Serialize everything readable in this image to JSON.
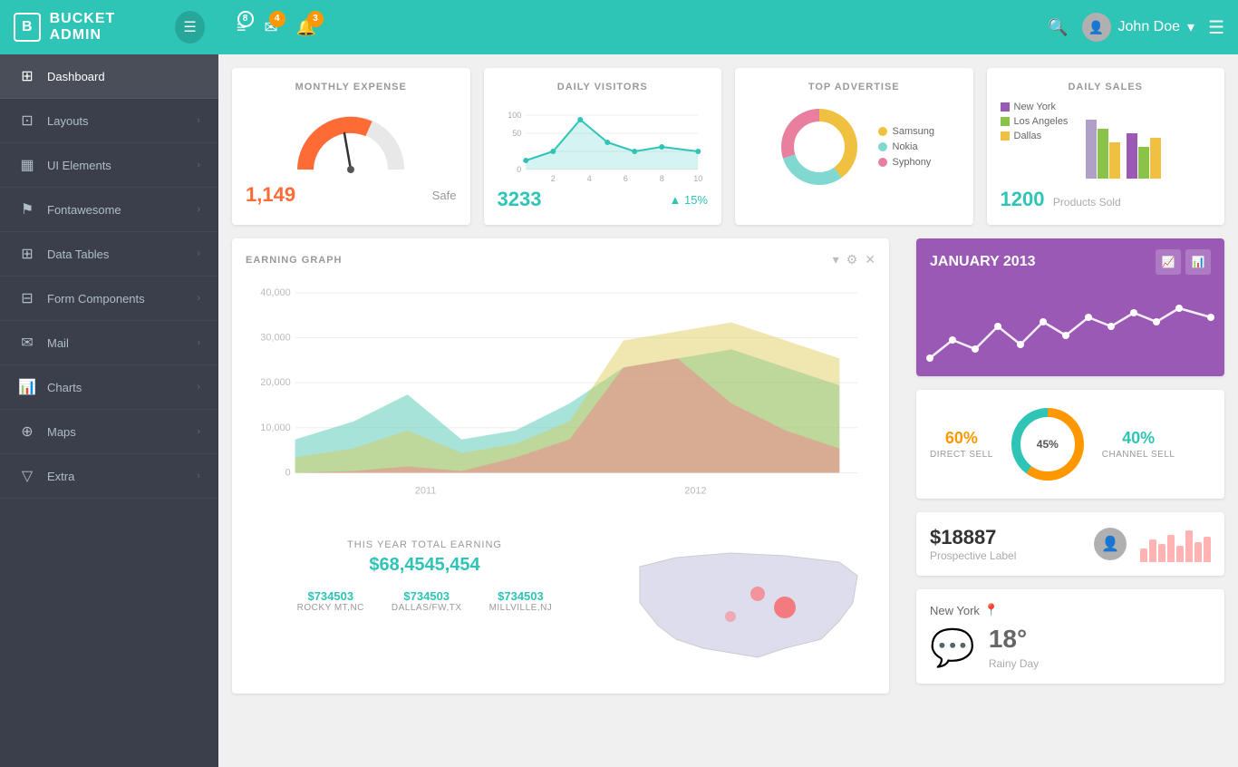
{
  "brand": {
    "title": "BUCKET ADMIN",
    "icon": "B"
  },
  "header": {
    "badges": {
      "menu": "8",
      "mail": "4",
      "bell": "3"
    },
    "user": "John Doe",
    "search_placeholder": "Search..."
  },
  "sidebar": {
    "items": [
      {
        "label": "Dashboard",
        "icon": "⊞",
        "active": true
      },
      {
        "label": "Layouts",
        "icon": "⊡",
        "active": false
      },
      {
        "label": "UI Elements",
        "icon": "▦",
        "active": false
      },
      {
        "label": "Fontawesome",
        "icon": "⚑",
        "active": false
      },
      {
        "label": "Data Tables",
        "icon": "⊞",
        "active": false
      },
      {
        "label": "Form Components",
        "icon": "⊟",
        "active": false
      },
      {
        "label": "Mail",
        "icon": "✉",
        "active": false
      },
      {
        "label": "Charts",
        "icon": "⊞",
        "active": false
      },
      {
        "label": "Maps",
        "icon": "⊕",
        "active": false
      },
      {
        "label": "Extra",
        "icon": "▽",
        "active": false
      }
    ]
  },
  "stats": {
    "monthly_expense": {
      "title": "MONTHLY EXPENSE",
      "value": "1,149",
      "label": "Safe"
    },
    "daily_visitors": {
      "title": "DAILY VISITORS",
      "value": "3233",
      "change": "15%"
    },
    "top_advertise": {
      "title": "TOP ADVERTISE",
      "legend": [
        {
          "label": "Samsung",
          "color": "#f0c040"
        },
        {
          "label": "Nokia",
          "color": "#80d8d0"
        },
        {
          "label": "Syphony",
          "color": "#e87f9e"
        }
      ]
    },
    "daily_sales": {
      "title": "DAILY SALES",
      "value": "1200",
      "label": "Products Sold",
      "legend": [
        {
          "label": "New York",
          "color": "#9b59b6"
        },
        {
          "label": "Los Angeles",
          "color": "#8bc34a"
        },
        {
          "label": "Dallas",
          "color": "#f0c040"
        }
      ]
    }
  },
  "earning_graph": {
    "title": "EARNING GRAPH",
    "this_year_label": "THIS YEAR TOTAL EARNING",
    "this_year_amount": "$68,4545,454",
    "locations": [
      {
        "amount": "$734503",
        "name": "ROCKY MT,NC"
      },
      {
        "amount": "$734503",
        "name": "DALLAS/FW,TX"
      },
      {
        "amount": "$734503",
        "name": "MILLVILLE,NJ"
      }
    ],
    "years": [
      "2011",
      "2012"
    ],
    "y_axis": [
      "40,000",
      "30,000",
      "20,000",
      "10,000",
      "0"
    ]
  },
  "january": {
    "title": "JANUARY 2013"
  },
  "sell": {
    "direct_percent": "60%",
    "direct_label": "DIRECT SELL",
    "channel_percent": "40%",
    "channel_label": "CHANNEL SELL",
    "donut_center": "45%",
    "id": "6086 4000"
  },
  "prospective": {
    "amount": "$18887",
    "label": "Prospective Label"
  },
  "weather": {
    "city": "New York",
    "temp": "18°",
    "desc": "Rainy Day",
    "icon": "💬"
  }
}
